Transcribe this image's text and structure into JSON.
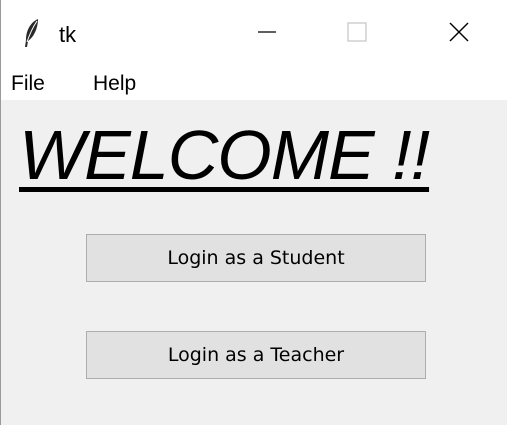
{
  "window": {
    "title": "tk",
    "app_icon": "feather-icon",
    "controls": {
      "minimize_icon": "minimize-icon",
      "maximize_icon": "maximize-icon",
      "close_icon": "close-icon"
    }
  },
  "menubar": {
    "items": [
      {
        "label": "File"
      },
      {
        "label": "Help"
      }
    ]
  },
  "main": {
    "heading": "WELCOME !!",
    "buttons": {
      "student": "Login as a Student",
      "teacher": "Login as a Teacher"
    }
  },
  "colors": {
    "window_bg": "#f0f0f0",
    "button_bg": "#e1e1e1",
    "button_border": "#adadad"
  }
}
